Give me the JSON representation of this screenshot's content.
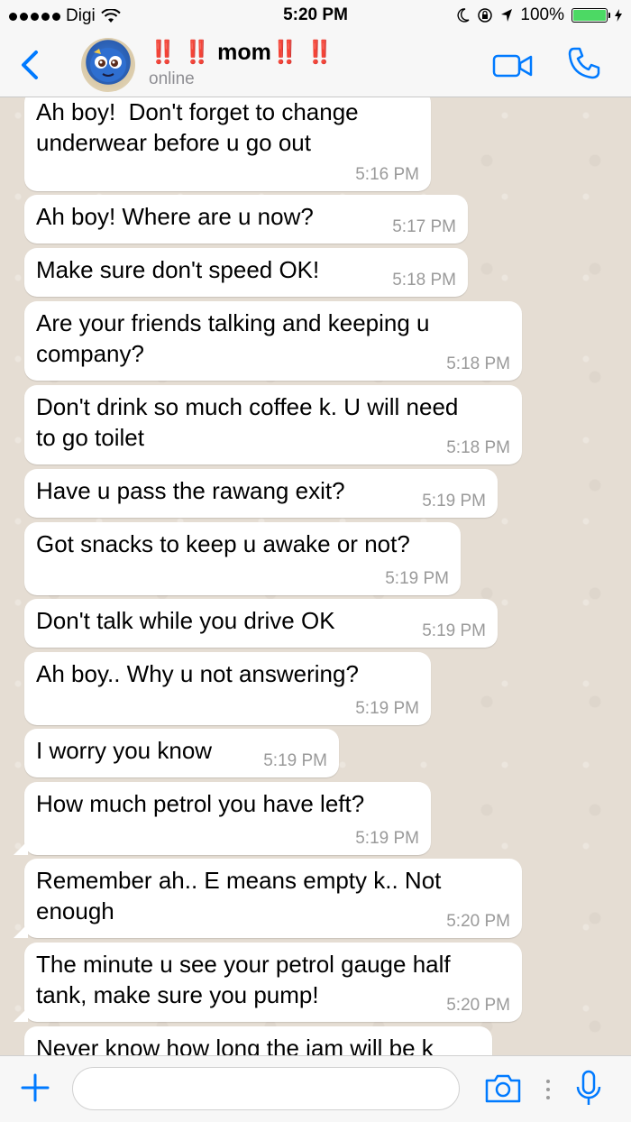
{
  "status_bar": {
    "carrier": "Digi",
    "time": "5:20 PM",
    "battery": "100%",
    "battery_level": 1.0
  },
  "header": {
    "contact_name": "‼️ ‼️ mom‼️ ‼️",
    "contact_status": "online"
  },
  "messages": [
    {
      "text": "Ah boy!  Don't forget to change\nunderwear before u go out",
      "time": "5:16 PM"
    },
    {
      "text": "Ah boy! Where are u now?",
      "time": "5:17 PM"
    },
    {
      "text": "Make sure don't speed OK!",
      "time": "5:18 PM"
    },
    {
      "text": "Are your friends talking and keeping u\ncompany?",
      "time": "5:18 PM"
    },
    {
      "text": "Don't drink so much coffee k. U will need\nto go toilet",
      "time": "5:18 PM"
    },
    {
      "text": "Have u pass the rawang exit?",
      "time": "5:19 PM"
    },
    {
      "text": "Got snacks to keep u awake or not?",
      "time": "5:19 PM"
    },
    {
      "text": "Don't talk while you drive OK",
      "time": "5:19 PM"
    },
    {
      "text": "Ah boy.. Why u not answering?",
      "time": "5:19 PM"
    },
    {
      "text": "I worry you know",
      "time": "5:19 PM"
    },
    {
      "text": "How much petrol you have left?",
      "time": "5:19 PM"
    },
    {
      "text": "Remember ah.. E means empty k.. Not\nenough",
      "time": "5:20 PM"
    },
    {
      "text": "The minute u see your petrol gauge half\ntank, make sure you pump!",
      "time": "5:20 PM"
    },
    {
      "text": "Never know how long the jam will be k",
      "time": ""
    }
  ],
  "input": {
    "placeholder": ""
  },
  "colors": {
    "accent": "#007aff",
    "chat_background": "#e5ddd3",
    "bubble": "#ffffff",
    "battery": "#4cd964"
  },
  "icons": {
    "back": "chevron-left-icon",
    "video": "video-camera-icon",
    "call": "phone-icon",
    "plus": "plus-icon",
    "camera": "camera-icon",
    "mic": "microphone-icon"
  }
}
